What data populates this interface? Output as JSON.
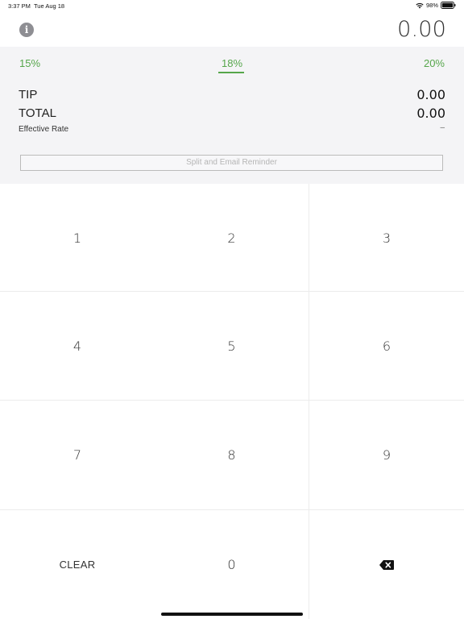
{
  "status_bar": {
    "time": "3:37 PM",
    "date": "Tue Aug 18",
    "battery": "98%",
    "icons": [
      "wifi-icon",
      "battery-icon"
    ]
  },
  "header": {
    "info_icon": "i",
    "bill_amount": "0.00"
  },
  "tip_options": {
    "option_15": "15%",
    "option_18": "18%",
    "option_20": "20%",
    "selected": "18%"
  },
  "summary": {
    "tip_label": "TIP",
    "tip_value": "0.00",
    "total_label": "TOTAL",
    "total_value": "0.00",
    "effective_rate_label": "Effective Rate",
    "effective_rate_value": "–"
  },
  "split_button": "Split and Email Reminder",
  "keypad": {
    "keys": [
      "1",
      "2",
      "3",
      "4",
      "5",
      "6",
      "7",
      "8",
      "9",
      "CLEAR",
      "0"
    ],
    "backspace_icon": "backspace-icon"
  },
  "colors": {
    "accent_green": "#56a64b",
    "panel_background": "#f4f4f6",
    "info_icon_gray": "#8e8e93"
  }
}
